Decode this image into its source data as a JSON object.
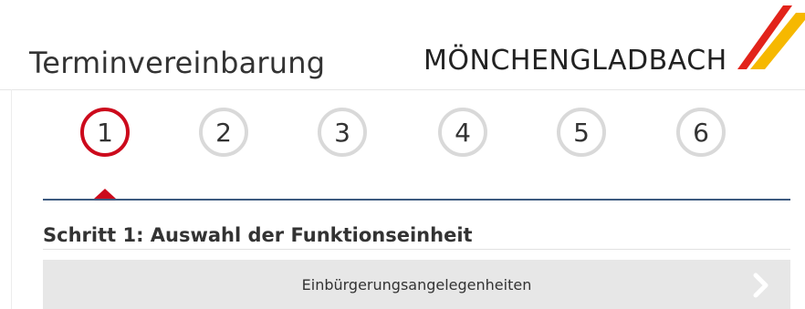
{
  "header": {
    "title": "Terminvereinbarung",
    "brand": "MÖNCHENGLADBACH"
  },
  "brand_colors": {
    "red": "#e2231a",
    "yellow": "#f6b800"
  },
  "steps": {
    "active": 1,
    "items": [
      {
        "label": "1"
      },
      {
        "label": "2"
      },
      {
        "label": "3"
      },
      {
        "label": "4"
      },
      {
        "label": "5"
      },
      {
        "label": "6"
      }
    ]
  },
  "main": {
    "heading": "Schritt 1: Auswahl der Funktionseinheit",
    "options": [
      {
        "label": "Einbürgerungsangelegenheiten",
        "icon": "chevron-right-icon"
      }
    ]
  }
}
